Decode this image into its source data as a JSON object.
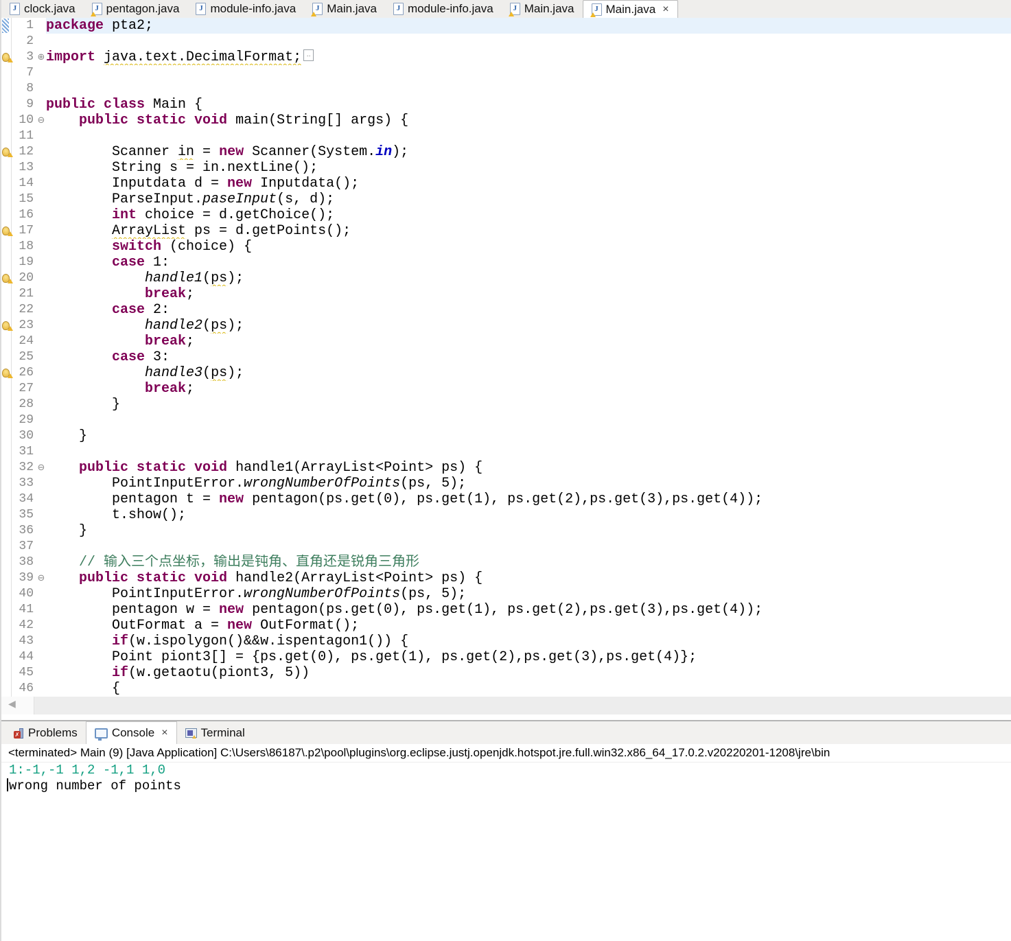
{
  "icons": {
    "java_file": "J",
    "close": "×",
    "fold_collapsed": "⊕",
    "fold_expanded": "⊖",
    "scroll_left": "◀"
  },
  "colors": {
    "keyword": "#7f0055",
    "comment": "#3f7f5f",
    "static_field": "#0000c0",
    "current_line_bg": "#e7f2fc",
    "console_input": "#14a082",
    "warning_underline": "#d9b60a"
  },
  "editor_tabs": [
    {
      "label": "clock.java",
      "warn": false,
      "active": false
    },
    {
      "label": "pentagon.java",
      "warn": true,
      "active": false
    },
    {
      "label": "module-info.java",
      "warn": false,
      "active": false
    },
    {
      "label": "Main.java",
      "warn": true,
      "active": false
    },
    {
      "label": "module-info.java",
      "warn": false,
      "active": false
    },
    {
      "label": "Main.java",
      "warn": true,
      "active": false
    },
    {
      "label": "Main.java",
      "warn": true,
      "active": true
    }
  ],
  "code": {
    "lines": [
      {
        "n": "1",
        "ind": 0,
        "hl": true,
        "range": true,
        "seg": [
          [
            "k",
            "package"
          ],
          [
            "p",
            " pta2;"
          ]
        ]
      },
      {
        "n": "2",
        "ind": 0,
        "seg": []
      },
      {
        "n": "3",
        "ind": 0,
        "warn": true,
        "fold": "c",
        "seg": [
          [
            "k",
            "import"
          ],
          [
            "p",
            " "
          ],
          [
            "w",
            "java.text.DecimalFormat;"
          ],
          [
            "b",
            ""
          ]
        ]
      },
      {
        "n": "7",
        "ind": 0,
        "seg": []
      },
      {
        "n": "8",
        "ind": 0,
        "seg": []
      },
      {
        "n": "9",
        "ind": 0,
        "seg": [
          [
            "k",
            "public class"
          ],
          [
            "p",
            " Main {"
          ]
        ]
      },
      {
        "n": "10",
        "ind": 4,
        "fold": "e",
        "seg": [
          [
            "k",
            "public static void"
          ],
          [
            "p",
            " main(String[] args) {"
          ]
        ]
      },
      {
        "n": "11",
        "ind": 0,
        "seg": []
      },
      {
        "n": "12",
        "ind": 8,
        "warn": true,
        "seg": [
          [
            "p",
            "Scanner "
          ],
          [
            "w",
            "in"
          ],
          [
            "p",
            " = "
          ],
          [
            "k",
            "new"
          ],
          [
            "p",
            " Scanner(System."
          ],
          [
            "f",
            "in"
          ],
          [
            "p",
            ");"
          ]
        ]
      },
      {
        "n": "13",
        "ind": 8,
        "seg": [
          [
            "p",
            "String s = in.nextLine();"
          ]
        ]
      },
      {
        "n": "14",
        "ind": 8,
        "seg": [
          [
            "p",
            "Inputdata d = "
          ],
          [
            "k",
            "new"
          ],
          [
            "p",
            " Inputdata();"
          ]
        ]
      },
      {
        "n": "15",
        "ind": 8,
        "seg": [
          [
            "p",
            "ParseInput."
          ],
          [
            "m",
            "paseInput"
          ],
          [
            "p",
            "(s, d);"
          ]
        ]
      },
      {
        "n": "16",
        "ind": 8,
        "seg": [
          [
            "k",
            "int"
          ],
          [
            "p",
            " choice = d.getChoice();"
          ]
        ]
      },
      {
        "n": "17",
        "ind": 8,
        "warn": true,
        "seg": [
          [
            "w",
            "ArrayList"
          ],
          [
            "p",
            " ps = d.getPoints();"
          ]
        ]
      },
      {
        "n": "18",
        "ind": 8,
        "seg": [
          [
            "k",
            "switch"
          ],
          [
            "p",
            " (choice) {"
          ]
        ]
      },
      {
        "n": "19",
        "ind": 8,
        "seg": [
          [
            "k",
            "case"
          ],
          [
            "p",
            " 1:"
          ]
        ]
      },
      {
        "n": "20",
        "ind": 12,
        "warn": true,
        "seg": [
          [
            "m",
            "handle1"
          ],
          [
            "p",
            "("
          ],
          [
            "w",
            "ps"
          ],
          [
            "p",
            ");"
          ]
        ]
      },
      {
        "n": "21",
        "ind": 12,
        "seg": [
          [
            "k",
            "break"
          ],
          [
            "p",
            ";"
          ]
        ]
      },
      {
        "n": "22",
        "ind": 8,
        "seg": [
          [
            "k",
            "case"
          ],
          [
            "p",
            " 2:"
          ]
        ]
      },
      {
        "n": "23",
        "ind": 12,
        "warn": true,
        "seg": [
          [
            "m",
            "handle2"
          ],
          [
            "p",
            "("
          ],
          [
            "w",
            "ps"
          ],
          [
            "p",
            ");"
          ]
        ]
      },
      {
        "n": "24",
        "ind": 12,
        "seg": [
          [
            "k",
            "break"
          ],
          [
            "p",
            ";"
          ]
        ]
      },
      {
        "n": "25",
        "ind": 8,
        "seg": [
          [
            "k",
            "case"
          ],
          [
            "p",
            " 3:"
          ]
        ]
      },
      {
        "n": "26",
        "ind": 12,
        "warn": true,
        "seg": [
          [
            "m",
            "handle3"
          ],
          [
            "p",
            "("
          ],
          [
            "w",
            "ps"
          ],
          [
            "p",
            ");"
          ]
        ]
      },
      {
        "n": "27",
        "ind": 12,
        "seg": [
          [
            "k",
            "break"
          ],
          [
            "p",
            ";"
          ]
        ]
      },
      {
        "n": "28",
        "ind": 8,
        "seg": [
          [
            "p",
            "}"
          ]
        ]
      },
      {
        "n": "29",
        "ind": 0,
        "seg": []
      },
      {
        "n": "30",
        "ind": 4,
        "seg": [
          [
            "p",
            "}"
          ]
        ]
      },
      {
        "n": "31",
        "ind": 0,
        "seg": []
      },
      {
        "n": "32",
        "ind": 4,
        "fold": "e",
        "seg": [
          [
            "k",
            "public static void"
          ],
          [
            "p",
            " handle1(ArrayList<Point> ps) {"
          ]
        ]
      },
      {
        "n": "33",
        "ind": 8,
        "seg": [
          [
            "p",
            "PointInputError."
          ],
          [
            "m",
            "wrongNumberOfPoints"
          ],
          [
            "p",
            "(ps, 5);"
          ]
        ]
      },
      {
        "n": "34",
        "ind": 8,
        "seg": [
          [
            "p",
            "pentagon t = "
          ],
          [
            "k",
            "new"
          ],
          [
            "p",
            " pentagon(ps.get(0), ps.get(1), ps.get(2),ps.get(3),ps.get(4));"
          ]
        ]
      },
      {
        "n": "35",
        "ind": 8,
        "seg": [
          [
            "p",
            "t.show();"
          ]
        ]
      },
      {
        "n": "36",
        "ind": 4,
        "seg": [
          [
            "p",
            "}"
          ]
        ]
      },
      {
        "n": "37",
        "ind": 0,
        "seg": []
      },
      {
        "n": "38",
        "ind": 4,
        "seg": [
          [
            "c",
            "// 输入三个点坐标，输出是钝角、直角还是锐角三角形"
          ]
        ]
      },
      {
        "n": "39",
        "ind": 4,
        "fold": "e",
        "seg": [
          [
            "k",
            "public static void"
          ],
          [
            "p",
            " handle2(ArrayList<Point> ps) {"
          ]
        ]
      },
      {
        "n": "40",
        "ind": 8,
        "seg": [
          [
            "p",
            "PointInputError."
          ],
          [
            "m",
            "wrongNumberOfPoints"
          ],
          [
            "p",
            "(ps, 5);"
          ]
        ]
      },
      {
        "n": "41",
        "ind": 8,
        "seg": [
          [
            "p",
            "pentagon w = "
          ],
          [
            "k",
            "new"
          ],
          [
            "p",
            " pentagon(ps.get(0), ps.get(1), ps.get(2),ps.get(3),ps.get(4));"
          ]
        ]
      },
      {
        "n": "42",
        "ind": 8,
        "seg": [
          [
            "p",
            "OutFormat a = "
          ],
          [
            "k",
            "new"
          ],
          [
            "p",
            " OutFormat();"
          ]
        ]
      },
      {
        "n": "43",
        "ind": 8,
        "seg": [
          [
            "k",
            "if"
          ],
          [
            "p",
            "(w.ispolygon()&&w.ispentagon1()) {"
          ]
        ]
      },
      {
        "n": "44",
        "ind": 8,
        "seg": [
          [
            "p",
            "Point piont3[] = {ps.get(0), ps.get(1), ps.get(2),ps.get(3),ps.get(4)};"
          ]
        ]
      },
      {
        "n": "45",
        "ind": 8,
        "seg": [
          [
            "k",
            "if"
          ],
          [
            "p",
            "(w.getaotu(piont3, 5))"
          ]
        ]
      },
      {
        "n": "46",
        "ind": 8,
        "seg": [
          [
            "p",
            "{"
          ]
        ]
      }
    ]
  },
  "bottom_tabs": [
    {
      "label": "Problems",
      "icon": "problems-icon",
      "active": false
    },
    {
      "label": "Console",
      "icon": "console-icon",
      "active": true
    },
    {
      "label": "Terminal",
      "icon": "terminal-icon",
      "active": false
    }
  ],
  "console": {
    "status": "<terminated> Main (9) [Java Application] C:\\Users\\86187\\.p2\\pool\\plugins\\org.eclipse.justj.openjdk.hotspot.jre.full.win32.x86_64_17.0.2.v20220201-1208\\jre\\bin",
    "lines": [
      {
        "kind": "input",
        "text": "1:-1,-1 1,2 -1,1 1,0",
        "cursor": false
      },
      {
        "kind": "output",
        "text": "wrong number of points",
        "cursor": true
      }
    ]
  }
}
